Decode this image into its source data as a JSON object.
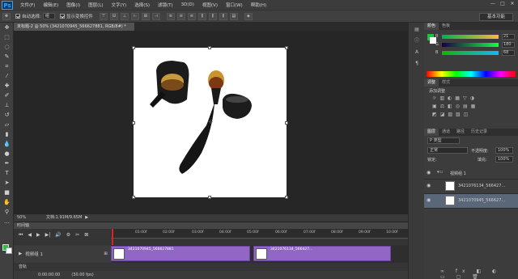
{
  "app": {
    "logo": "Ps"
  },
  "menu": [
    "文件(F)",
    "编辑(E)",
    "图像(I)",
    "图层(L)",
    "文字(Y)",
    "选择(S)",
    "滤镜(T)",
    "3D(D)",
    "视图(V)",
    "窗口(W)",
    "帮助(H)"
  ],
  "window_controls": [
    "—",
    "□",
    "✕"
  ],
  "options": {
    "auto_select_label": "自动选择:",
    "auto_select_value": "组",
    "show_transform_label": "显示变换控件",
    "workspace": "基本功能"
  },
  "document": {
    "tab_title": "未标题-2 @ 50% (3421070945_566627881, RGB/8#) *",
    "zoom": "50%",
    "doc_info": "文档:1.91M/9.65M"
  },
  "timeline": {
    "title": "时间轴",
    "ticks": [
      "01:00f",
      "02:00f",
      "03:00f",
      "04:00f",
      "05:00f",
      "06:00f",
      "07:00f",
      "08:00f",
      "09:00f",
      "10:00f"
    ],
    "track_name": "视频组 1",
    "clips": [
      {
        "name": "3421070945_566627881"
      },
      {
        "name": "3421076134_566427..."
      }
    ],
    "audio_label": "音轨",
    "timecode": "0:00:00:00",
    "fps": "(30.00 fps)"
  },
  "color_panel": {
    "tabs": [
      "颜色",
      "色板"
    ],
    "channels": [
      {
        "label": "R",
        "value": "21",
        "level": 0.08
      },
      {
        "label": "G",
        "value": "180",
        "level": 0.71
      },
      {
        "label": "B",
        "value": "68",
        "level": 0.27
      }
    ],
    "fg_color": "#1ec43f"
  },
  "adjust_panel": {
    "tabs": [
      "调整",
      "样式"
    ],
    "add_label": "添加调整"
  },
  "layers_panel": {
    "tabs": [
      "图层",
      "通道",
      "路径",
      "历史记录"
    ],
    "kind": "P 类型",
    "blend_mode": "正常",
    "opacity_label": "不透明度:",
    "opacity": "100%",
    "lock_label": "锁定:",
    "fill_label": "填充:",
    "fill": "100%",
    "group_name": "视频组 1",
    "layers": [
      "3421076134_566427...",
      "3421070945_566627..."
    ]
  }
}
